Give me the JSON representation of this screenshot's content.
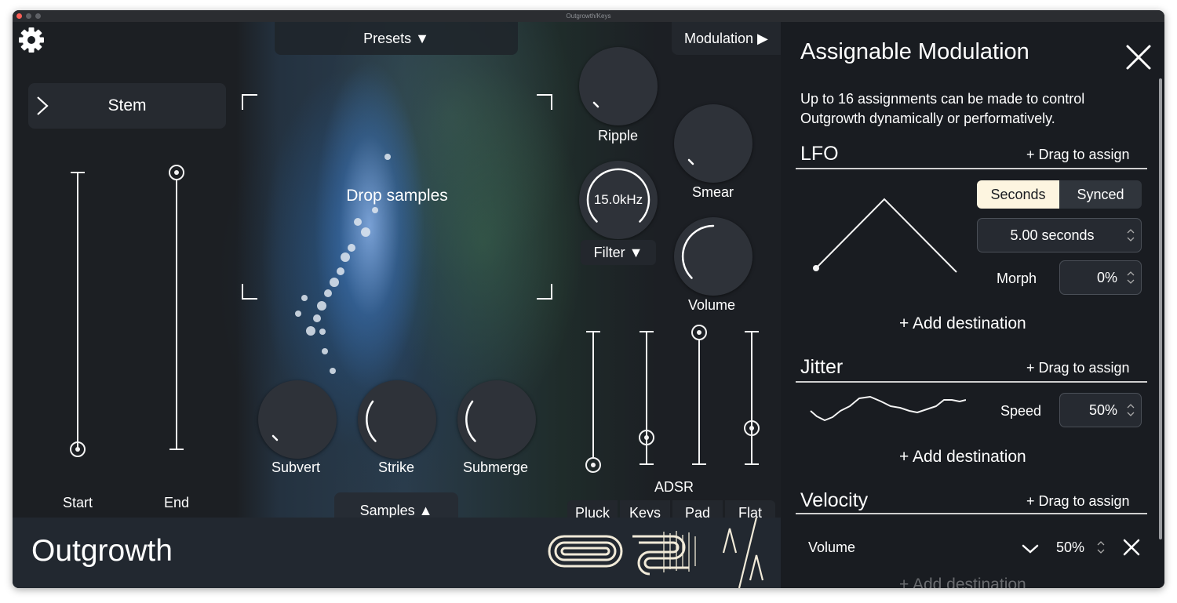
{
  "window": {
    "title": "Outgrowth/Keys"
  },
  "top": {
    "presets_label": "Presets ▼",
    "modulation_label": "Modulation ▶"
  },
  "stem": {
    "label": "Stem",
    "arrow": ">"
  },
  "sliders": {
    "start_label": "Start",
    "end_label": "End"
  },
  "drop": {
    "label": "Drop samples"
  },
  "knobs": {
    "ripple": "Ripple",
    "smear": "Smear",
    "filter_value": "15.0kHz",
    "filter_label": "Filter ▼",
    "volume": "Volume",
    "subvert": "Subvert",
    "strike": "Strike",
    "submerge": "Submerge"
  },
  "adsr": {
    "label": "ADSR",
    "presets": [
      "Pluck",
      "Keys",
      "Pad",
      "Flat"
    ]
  },
  "samples_button": "Samples ▲",
  "brand": {
    "name": "Outgrowth"
  },
  "panel": {
    "title": "Assignable Modulation",
    "description_line1": "Up to 16 assignments can be made to control",
    "description_line2": "Outgrowth dynamically or performatively.",
    "lfo": {
      "title": "LFO",
      "drag": "+ Drag to assign",
      "mode_seconds": "Seconds",
      "mode_synced": "Synced",
      "rate": "5.00 seconds",
      "morph_label": "Morph",
      "morph_value": "0%",
      "add_destination": "+ Add destination"
    },
    "jitter": {
      "title": "Jitter",
      "drag": "+ Drag to assign",
      "speed_label": "Speed",
      "speed_value": "50%",
      "add_destination": "+ Add destination"
    },
    "velocity": {
      "title": "Velocity",
      "drag": "+ Drag to assign",
      "destination": "Volume",
      "amount": "50%",
      "add_destination": "+ Add destination"
    }
  },
  "icons": {
    "settings": "gear-icon",
    "close": "close-icon",
    "stem_arrow": "chevron-right-icon"
  },
  "colors": {
    "background": "#1a1d22",
    "panel": "#191c21",
    "footer": "#222830",
    "knob": "#2e3239",
    "text": "#ffffff",
    "segment_active": "#fdf5e0"
  }
}
